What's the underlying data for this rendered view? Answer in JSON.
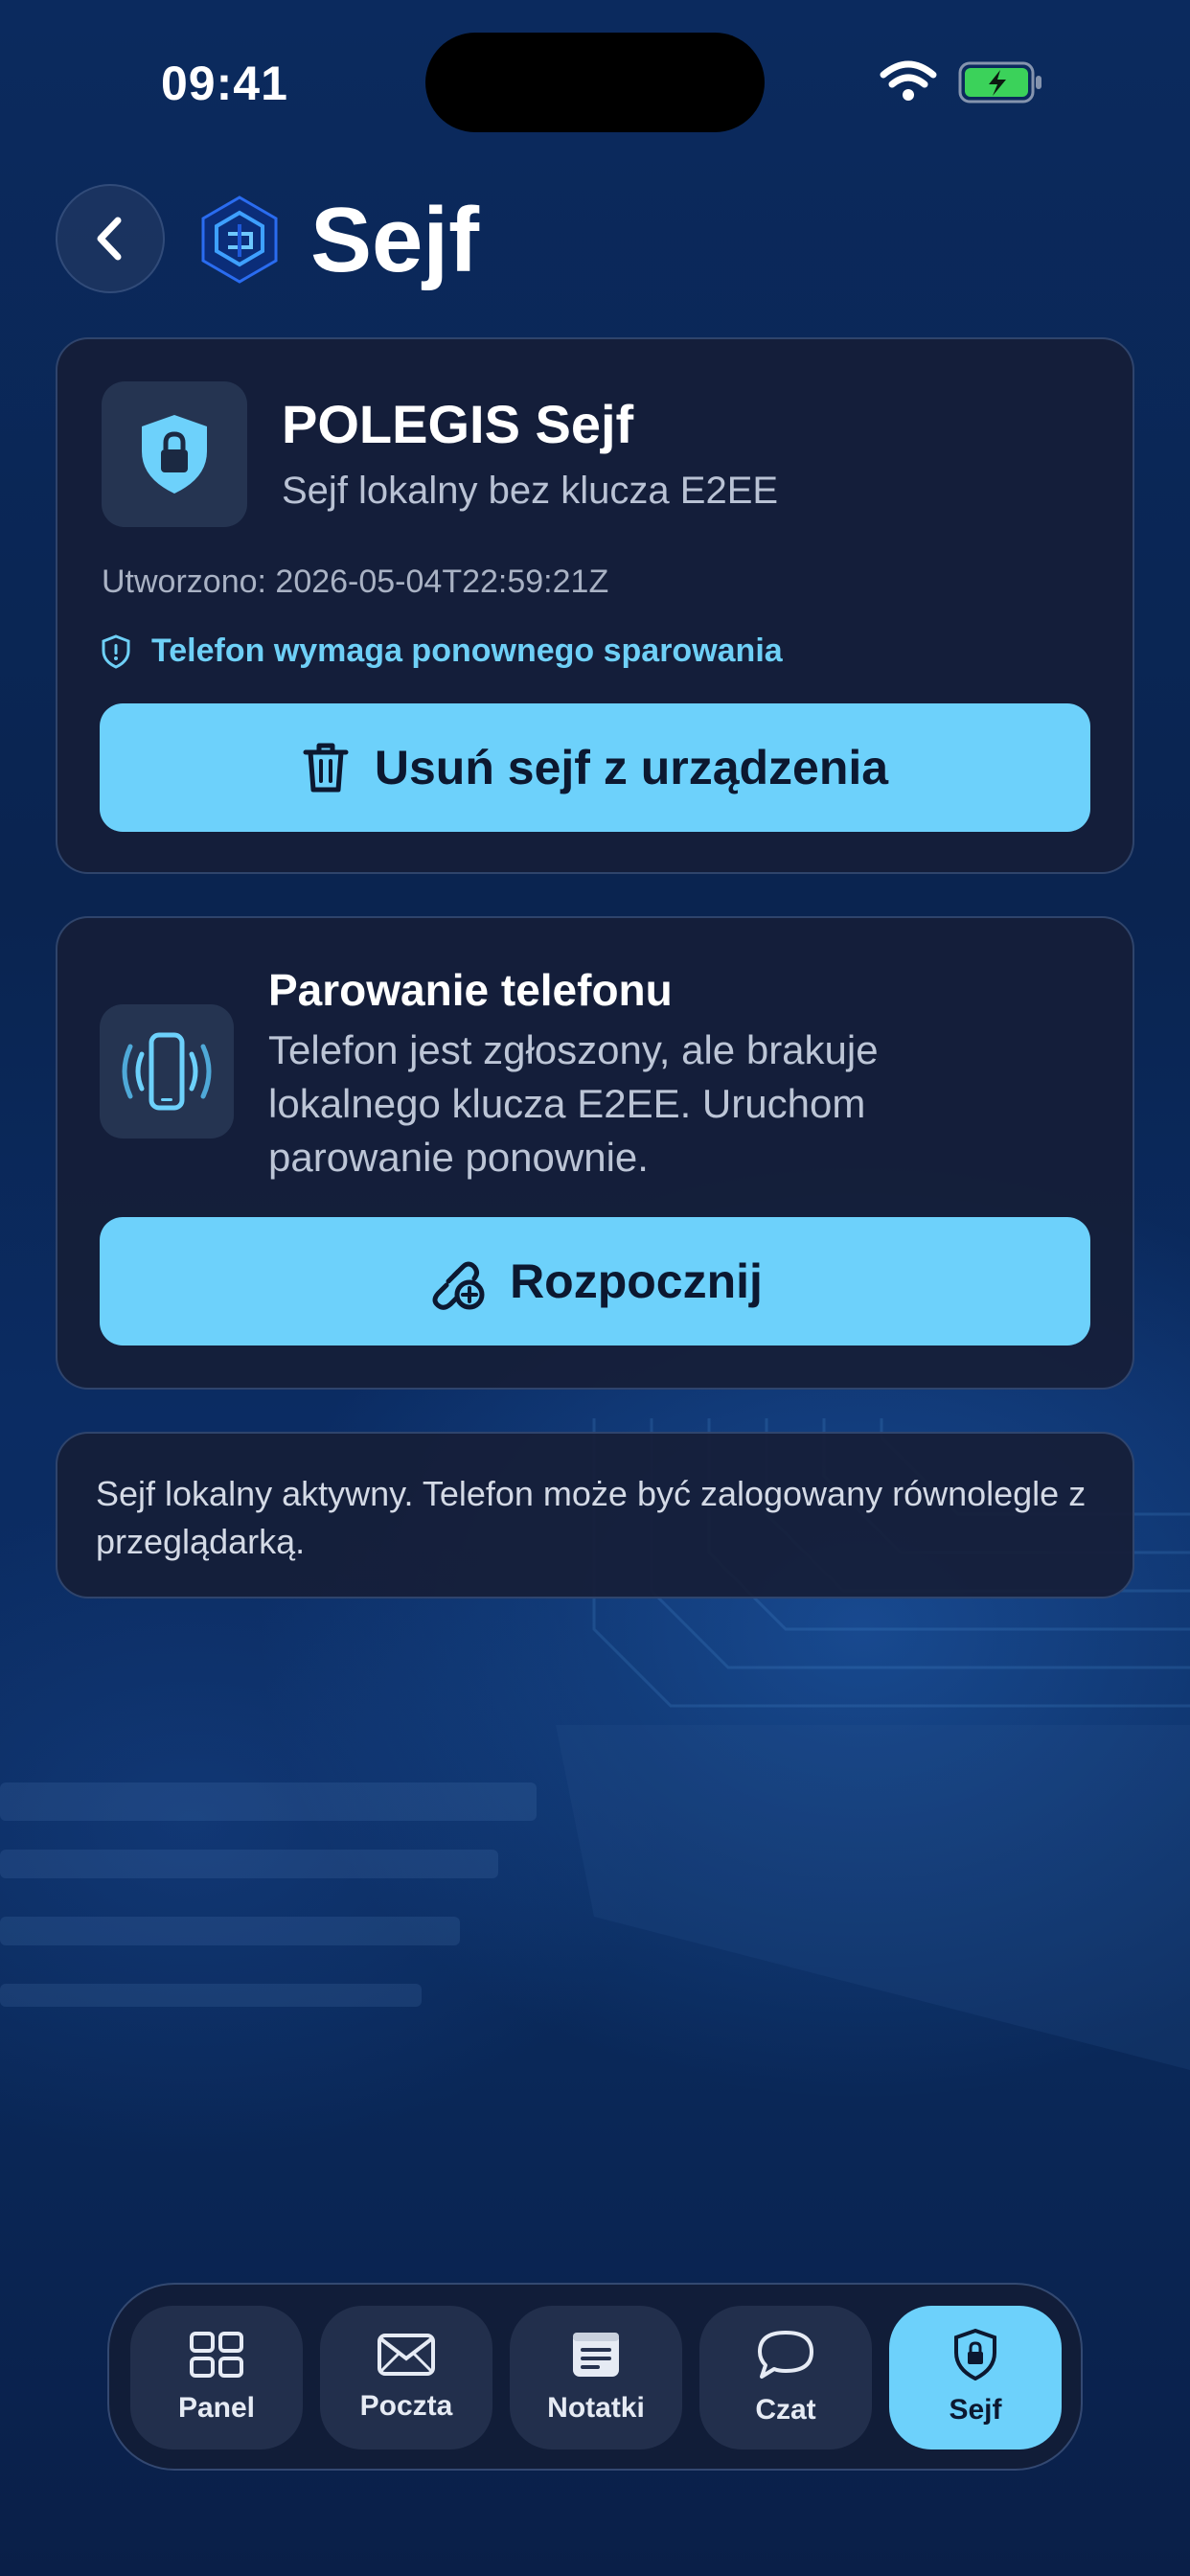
{
  "status_bar": {
    "time": "09:41"
  },
  "header": {
    "title": "Sejf",
    "back_icon": "chevron-left-icon",
    "logo_icon": "polegis-logo-icon"
  },
  "vault_card": {
    "title": "POLEGIS Sejf",
    "subtitle": "Sejf lokalny bez klucza E2EE",
    "created": "Utworzono: 2026-05-04T22:59:21Z",
    "warning": "Telefon wymaga ponownego sparowania",
    "delete_button": "Usuń sejf z urządzenia"
  },
  "pairing_card": {
    "title": "Parowanie telefonu",
    "description": "Telefon jest zgłoszony, ale brakuje lokalnego klucza E2EE. Uruchom parowanie ponownie.",
    "start_button": "Rozpocznij"
  },
  "info_card": {
    "text": "Sejf lokalny aktywny. Telefon może być zalogowany równolegle z przeglądarką."
  },
  "tabbar": {
    "items": [
      {
        "label": "Panel",
        "icon": "grid-icon"
      },
      {
        "label": "Poczta",
        "icon": "mail-icon"
      },
      {
        "label": "Notatki",
        "icon": "notes-icon"
      },
      {
        "label": "Czat",
        "icon": "chat-bubble-icon"
      },
      {
        "label": "Sejf",
        "icon": "shield-lock-icon",
        "active": true
      }
    ]
  },
  "colors": {
    "accent": "#6dd1fb",
    "card": "#161e38",
    "warning_text": "#6ed0f7"
  }
}
